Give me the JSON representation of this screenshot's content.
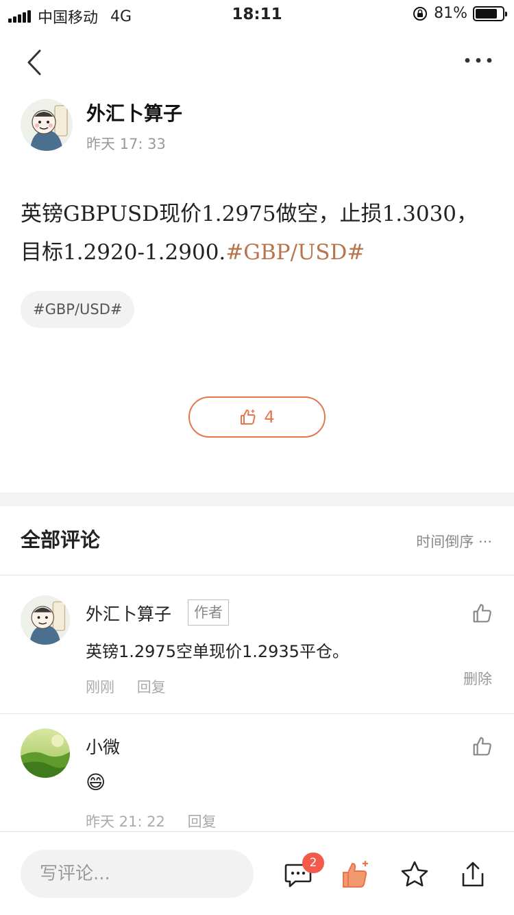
{
  "status_bar": {
    "carrier": "中国移动",
    "network": "4G",
    "time": "18:11",
    "battery": "81%",
    "battery_level": 0.81
  },
  "post": {
    "author": "外汇卜算子",
    "time": "昨天 17: 33",
    "text": "英镑GBPUSD现价1.2975做空，止损1.3030，目标1.2920-1.2900.",
    "hashtag_inline": "#GBP/USD#",
    "tag_chip": "#GBP/USD#",
    "like_count": "4"
  },
  "comments_section": {
    "title": "全部评论",
    "sort_label": "时间倒序 ···",
    "items": [
      {
        "name": "外汇卜算子",
        "badge": "作者",
        "text": "英镑1.2975空单现价1.2935平仓。",
        "time": "刚刚",
        "reply": "回复",
        "delete": "删除"
      },
      {
        "name": "小微",
        "text": "😄",
        "time": "昨天 21: 22",
        "reply": "回复"
      }
    ]
  },
  "bottom_bar": {
    "comment_placeholder": "写评论...",
    "comment_badge": "2"
  },
  "colors": {
    "accent": "#e8744c",
    "hashtag": "#b8744c",
    "badge": "#f25b4b"
  },
  "icons": [
    "back-chevron-icon",
    "more-icon",
    "thumbs-up-icon",
    "comment-icon",
    "star-icon",
    "share-icon"
  ]
}
